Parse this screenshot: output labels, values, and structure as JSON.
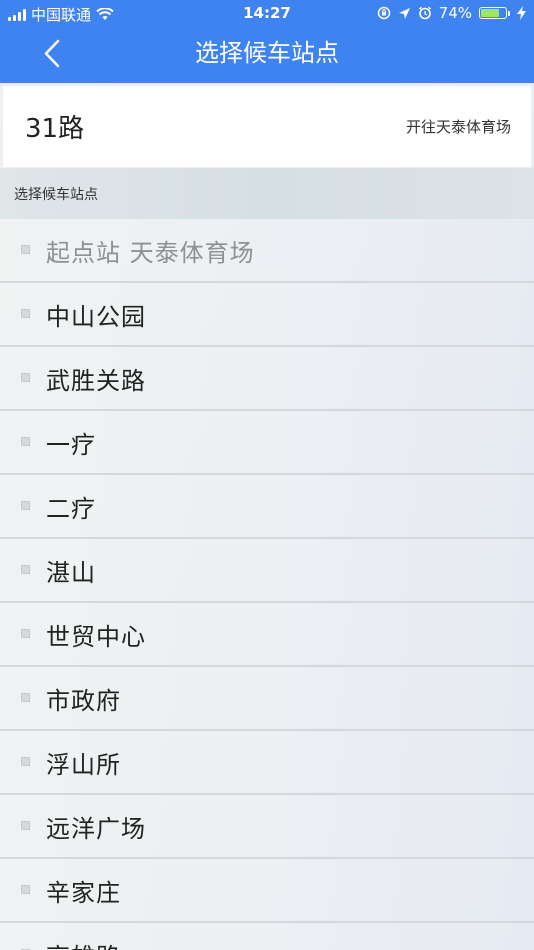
{
  "status_bar": {
    "carrier": "中国联通",
    "time": "14:27",
    "battery": "74%",
    "battery_level": 0.74
  },
  "nav": {
    "title": "选择候车站点"
  },
  "route": {
    "number": "31路",
    "direction": "开往天泰体育场"
  },
  "section": {
    "label": "选择候车站点"
  },
  "stops": [
    {
      "name": "起点站 天泰体育场"
    },
    {
      "name": "中山公园"
    },
    {
      "name": "武胜关路"
    },
    {
      "name": "一疗"
    },
    {
      "name": "二疗"
    },
    {
      "name": "湛山"
    },
    {
      "name": "世贸中心"
    },
    {
      "name": "市政府"
    },
    {
      "name": "浮山所"
    },
    {
      "name": "远洋广场"
    },
    {
      "name": "辛家庄"
    },
    {
      "name": "高雄路"
    }
  ]
}
